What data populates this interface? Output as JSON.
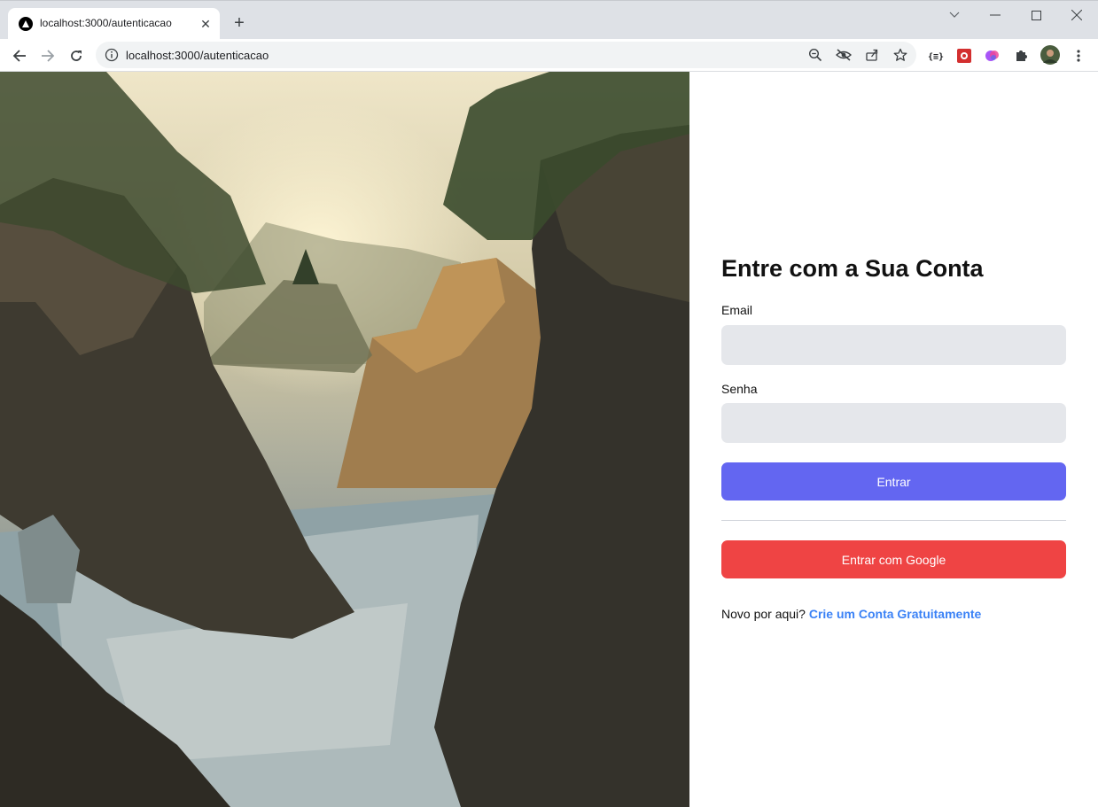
{
  "browser": {
    "tab_title": "localhost:3000/autenticacao",
    "url": "localhost:3000/autenticacao",
    "new_tab_label": "+",
    "close_tab_label": "✕"
  },
  "login": {
    "heading": "Entre com a Sua Conta",
    "email_label": "Email",
    "email_value": "",
    "password_label": "Senha",
    "password_value": "",
    "submit_label": "Entrar",
    "google_label": "Entrar com Google",
    "signup_prompt": "Novo por aqui?",
    "signup_link": "Crie um Conta Gratuitamente"
  },
  "colors": {
    "primary": "#6366f1",
    "google": "#ef4444",
    "link": "#3b82f6",
    "input_bg": "#e5e7eb"
  }
}
